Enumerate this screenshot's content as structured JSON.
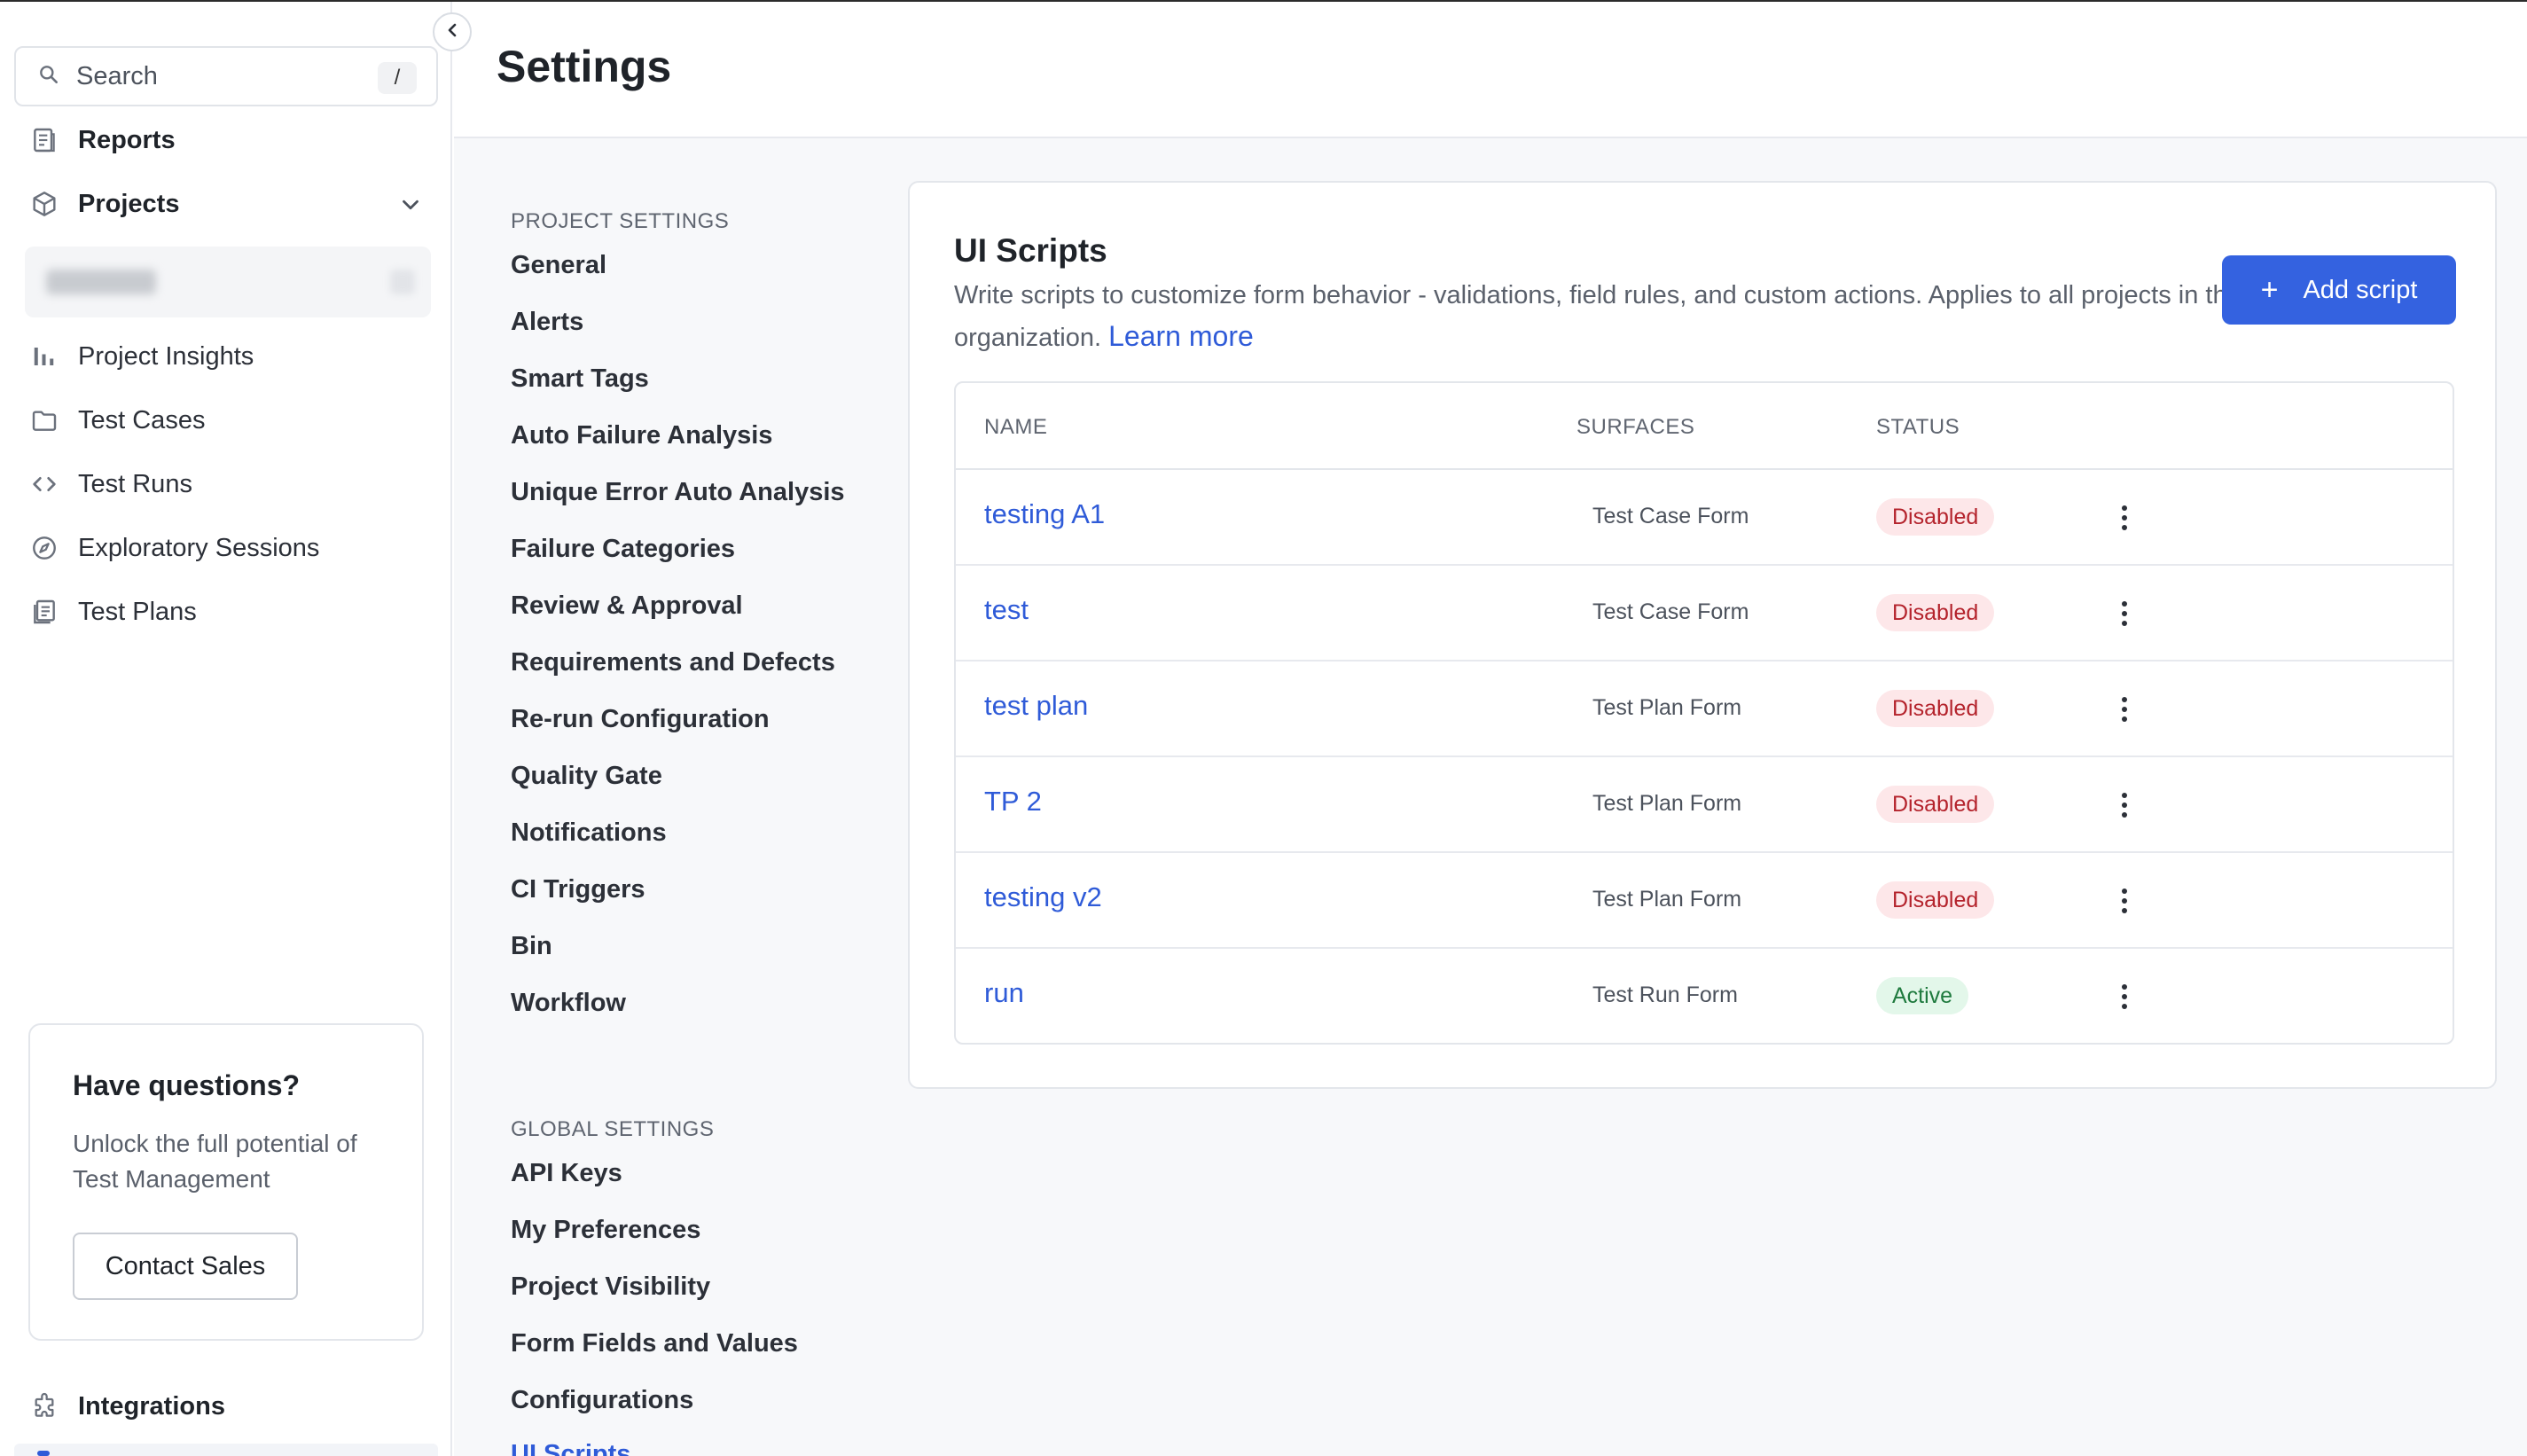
{
  "sidebar": {
    "search": {
      "label": "Search",
      "shortcut": "/"
    },
    "items": [
      {
        "label": "Reports",
        "icon": "reports-icon"
      },
      {
        "label": "Projects",
        "icon": "cube-icon"
      },
      {
        "label": "Project Insights",
        "icon": "bar-chart-icon"
      },
      {
        "label": "Test Cases",
        "icon": "folder-icon"
      },
      {
        "label": "Test Runs",
        "icon": "code-icon"
      },
      {
        "label": "Exploratory Sessions",
        "icon": "compass-icon"
      },
      {
        "label": "Test Plans",
        "icon": "document-list-icon"
      }
    ],
    "promo": {
      "title": "Have questions?",
      "text": "Unlock the full potential of Test Management",
      "button": "Contact Sales"
    },
    "integrations": {
      "label": "Integrations",
      "icon": "puzzle-icon"
    }
  },
  "header": {
    "title": "Settings"
  },
  "settings_nav": {
    "project_heading": "PROJECT SETTINGS",
    "project_items": [
      "General",
      "Alerts",
      "Smart Tags",
      "Auto Failure Analysis",
      "Unique Error Auto Analysis",
      "Failure Categories",
      "Review & Approval",
      "Requirements and Defects",
      "Re-run Configuration",
      "Quality Gate",
      "Notifications",
      "CI Triggers",
      "Bin",
      "Workflow"
    ],
    "global_heading": "GLOBAL SETTINGS",
    "global_items": [
      "API Keys",
      "My Preferences",
      "Project Visibility",
      "Form Fields and Values",
      "Configurations",
      "UI Scripts"
    ],
    "active_item": "UI Scripts"
  },
  "card": {
    "title": "UI Scripts",
    "description": "Write scripts to customize form behavior - validations, field rules, and custom actions. Applies to all projects in this organization.",
    "learn_more": "Learn more",
    "add_button": "Add script",
    "columns": [
      "NAME",
      "SURFACES",
      "STATUS"
    ],
    "rows": [
      {
        "name": "testing A1",
        "surface": "Test Case Form",
        "status": "Disabled"
      },
      {
        "name": "test",
        "surface": "Test Case Form",
        "status": "Disabled"
      },
      {
        "name": "test plan",
        "surface": "Test Plan Form",
        "status": "Disabled"
      },
      {
        "name": "TP 2",
        "surface": "Test Plan Form",
        "status": "Disabled"
      },
      {
        "name": "testing v2",
        "surface": "Test Plan Form",
        "status": "Disabled"
      },
      {
        "name": "run",
        "surface": "Test Run Form",
        "status": "Active"
      }
    ]
  },
  "colors": {
    "accent": "#3462e0",
    "link": "#2f5bd8",
    "disabled_bg": "#fde7e9",
    "disabled_text": "#b4232c",
    "active_bg": "#e3f7ea",
    "active_text": "#1f7a3e"
  }
}
